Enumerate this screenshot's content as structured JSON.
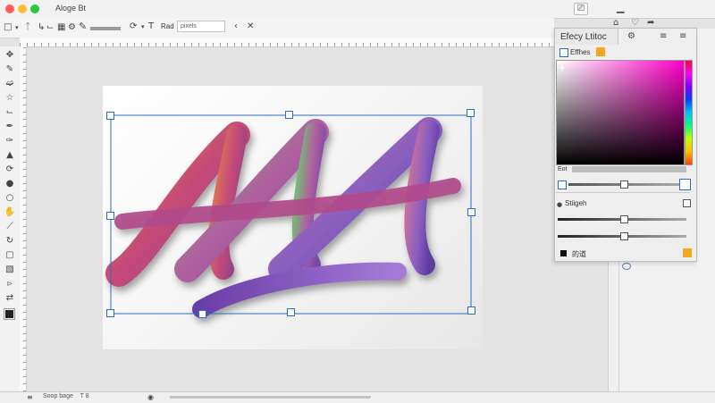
{
  "window": {
    "title": "Aloge Bt",
    "traffic_lights": [
      "#ff5f57",
      "#febc2e",
      "#28c840"
    ],
    "right_icons": [
      "exit-icon",
      "minimize-icon"
    ]
  },
  "options_bar": {
    "icons": [
      "new-doc-icon",
      "text-tool-icon",
      "cursor-icon",
      "crop-icon",
      "grid-icon",
      "gear-icon",
      "pen-icon",
      "stroke-preset-icon",
      "transform-icon",
      "type-icon"
    ],
    "radius_label": "Rad",
    "pixels_value": "pixels",
    "nav_icons": [
      "chevron-left-icon",
      "close-icon"
    ]
  },
  "top_right_icons": [
    "home-icon",
    "heart-icon",
    "share-icon"
  ],
  "tools": [
    "move-icon",
    "eraser-icon",
    "lasso-icon",
    "magic-wand-icon",
    "crop-icon",
    "eyedropper-icon",
    "brush-icon",
    "stamp-icon",
    "history-brush-icon",
    "pen-icon",
    "zoom-icon",
    "hand-icon",
    "line-icon",
    "rotate-icon",
    "shape-icon",
    "text-icon",
    "path-select-icon",
    "swap-icon",
    "color-swatch-icon"
  ],
  "artwork": {
    "text": "AAA",
    "colors": [
      "#e07a4f",
      "#c44a78",
      "#7bb37a",
      "#8a5fc0",
      "#6a3ea8",
      "#8c4ab0"
    ]
  },
  "effects_panel": {
    "title": "Efecy Ltitoc",
    "section_label": "Effhes",
    "color_label": "Eot",
    "stroke_label": "Stiigeh",
    "footer_label": "的道",
    "slider_levels": [
      0.55,
      0.55,
      0.55
    ],
    "accent": "#f5a623"
  },
  "status": {
    "text": "Soop bage",
    "zoom": "T 8"
  }
}
